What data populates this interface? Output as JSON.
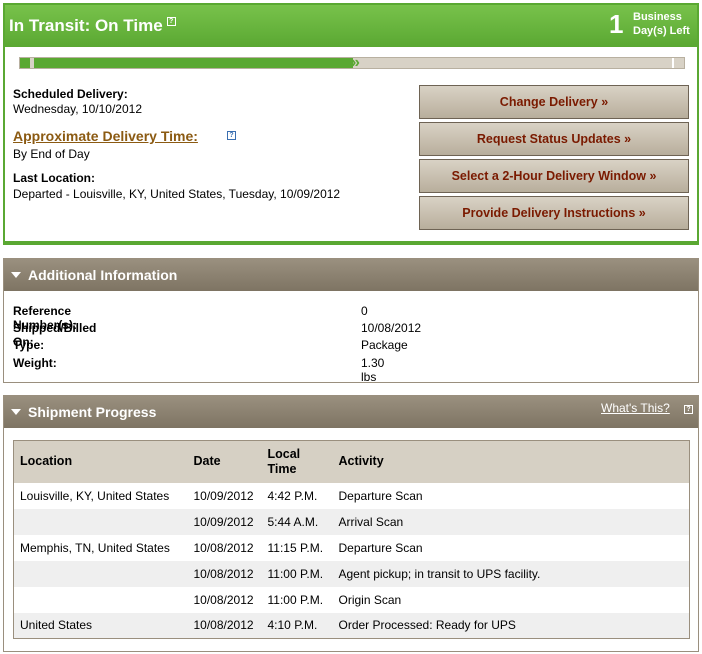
{
  "status": {
    "title": "In Transit: On Time",
    "days_left_value": "1",
    "days_left_label_line1": "Business",
    "days_left_label_line2": "Day(s) Left",
    "progress_fraction": 0.5,
    "scheduled_delivery_label": "Scheduled Delivery:",
    "scheduled_delivery_value": "Wednesday, 10/10/2012",
    "approx_time_label": "Approximate Delivery Time:",
    "approx_time_value": "By End of Day",
    "last_location_label": "Last Location:",
    "last_location_value": "Departed - Louisville, KY, United States, Tuesday, 10/09/2012",
    "help_icon_glyph": "?"
  },
  "actions": [
    {
      "label": "Change Delivery »"
    },
    {
      "label": "Request Status Updates »"
    },
    {
      "label": "Select a 2-Hour Delivery Window »"
    },
    {
      "label": "Provide Delivery Instructions »"
    }
  ],
  "additional_info": {
    "title": "Additional Information",
    "rows": [
      {
        "label": "Reference Number(s):",
        "value": "0"
      },
      {
        "label": "Shipped/Billed On:",
        "value": "10/08/2012"
      },
      {
        "label": "Type:",
        "value": "Package"
      },
      {
        "label": "Weight:",
        "value": "1.30 lbs"
      }
    ]
  },
  "shipment_progress": {
    "title": "Shipment Progress",
    "whats_this_label": "What's This?",
    "columns": {
      "location": "Location",
      "date": "Date",
      "local_time_line1": "Local",
      "local_time_line2": "Time",
      "activity": "Activity"
    },
    "rows": [
      {
        "location": "Louisville, KY, United States",
        "date": "10/09/2012",
        "time": "4:42 P.M.",
        "activity": "Departure Scan"
      },
      {
        "location": "",
        "date": "10/09/2012",
        "time": "5:44 A.M.",
        "activity": "Arrival Scan"
      },
      {
        "location": "Memphis, TN, United States",
        "date": "10/08/2012",
        "time": "11:15 P.M.",
        "activity": "Departure Scan"
      },
      {
        "location": "",
        "date": "10/08/2012",
        "time": "11:00 P.M.",
        "activity": "Agent pickup; in transit to UPS facility."
      },
      {
        "location": "",
        "date": "10/08/2012",
        "time": "11:00 P.M.",
        "activity": "Origin Scan"
      },
      {
        "location": "United States",
        "date": "10/08/2012",
        "time": "4:10 P.M.",
        "activity": "Order Processed: Ready for UPS"
      }
    ]
  },
  "colors": {
    "status_green": "#5aa832",
    "section_header": "#8a7f6e",
    "button_text": "#7a1a00",
    "link_brown": "#8b5a12"
  }
}
